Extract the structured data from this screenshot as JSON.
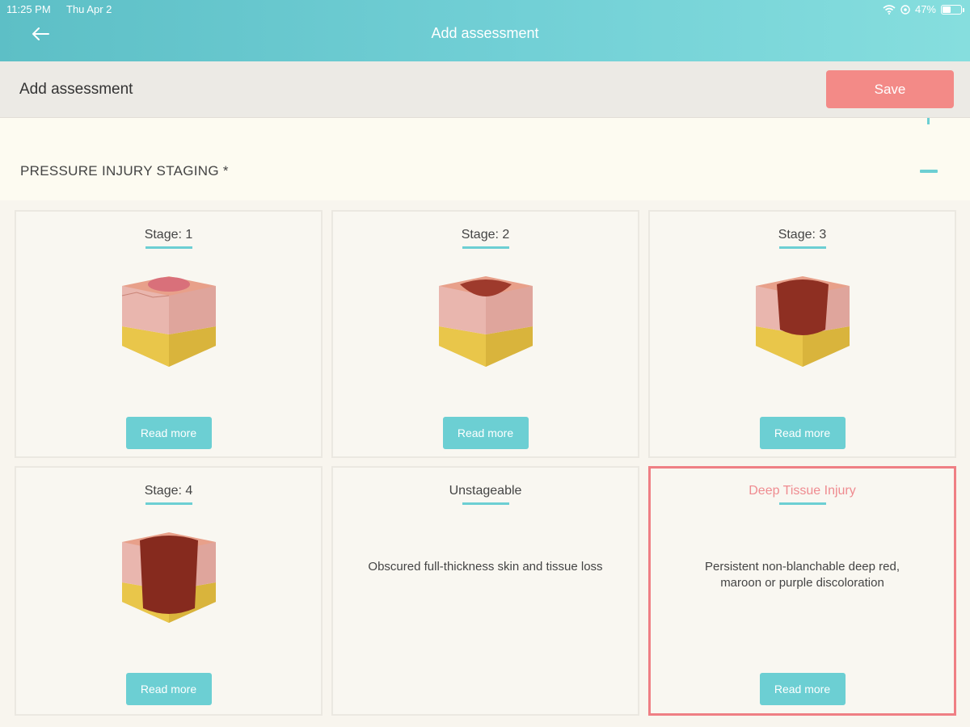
{
  "status": {
    "time": "11:25 PM",
    "date": "Thu Apr 2",
    "battery": "47%",
    "battery_level": 0.47
  },
  "nav": {
    "title": "Add assessment"
  },
  "header": {
    "title": "Add assessment",
    "save_label": "Save"
  },
  "section": {
    "title": "PRESSURE INJURY STAGING *"
  },
  "cards": [
    {
      "title": "Stage: 1",
      "read_more": "Read more",
      "illustration": "stage-1-wound"
    },
    {
      "title": "Stage: 2",
      "read_more": "Read more",
      "illustration": "stage-2-wound"
    },
    {
      "title": "Stage: 3",
      "read_more": "Read more",
      "illustration": "stage-3-wound"
    },
    {
      "title": "Stage: 4",
      "read_more": "Read more",
      "illustration": "stage-4-wound"
    },
    {
      "title": "Unstageable",
      "description": "Obscured full-thickness skin and tissue loss"
    },
    {
      "title": "Deep Tissue Injury",
      "description_line1": "Persistent non-blanchable deep red,",
      "description_line2": "maroon or purple discoloration",
      "read_more": "Read more",
      "selected": true
    }
  ],
  "colors": {
    "accent": "#6ccfd3",
    "save": "#f38a87",
    "selected_border": "#ef7f84"
  }
}
